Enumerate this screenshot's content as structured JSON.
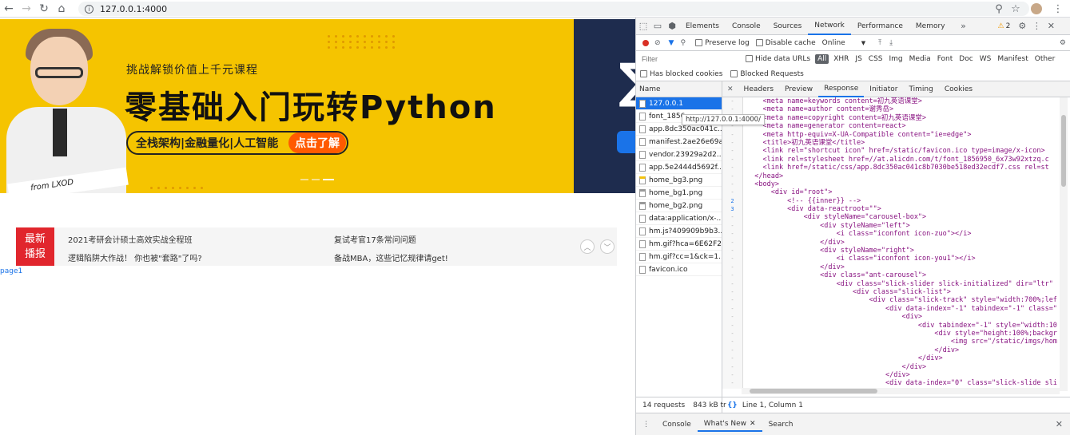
{
  "browser": {
    "url": "127.0.0.1:4000",
    "tooltip": "http://127.0.0.1:4000/"
  },
  "banner": {
    "subtitle": "挑战解锁价值上千元课程",
    "title": "零基础入门玩转Python",
    "tags": "全栈架构|金融量化|人工智能",
    "cta": "点击了解",
    "ribbon": "from LXOD"
  },
  "news": {
    "badge_line1": "最新",
    "badge_line2": "播报",
    "items": [
      "2021考研会计硕士高效实战全程班",
      "复试考官17条常问问题",
      "逻辑陷阱大作战！ 你也被\"套路\"了吗?",
      "备战MBA，这些记忆规律请get!"
    ],
    "page_link": "page1"
  },
  "devtools": {
    "tabs": [
      "Elements",
      "Console",
      "Sources",
      "Network",
      "Performance",
      "Memory"
    ],
    "warning_count": "2",
    "net": {
      "preserve_log": "Preserve log",
      "disable_cache": "Disable cache",
      "throttle": "Online"
    },
    "filter": {
      "placeholder": "Filter",
      "hide_data_urls": "Hide data URLs",
      "types": [
        "All",
        "XHR",
        "JS",
        "CSS",
        "Img",
        "Media",
        "Font",
        "Doc",
        "WS",
        "Manifest",
        "Other"
      ],
      "has_blocked_cookies": "Has blocked cookies",
      "blocked_requests": "Blocked Requests"
    },
    "list_header": "Name",
    "requests": [
      {
        "name": "127.0.0.1",
        "type": "doc"
      },
      {
        "name": "font_1856",
        "type": "doc"
      },
      {
        "name": "app.8dc350ac041c...",
        "type": "doc"
      },
      {
        "name": "manifest.2ae26e69a...",
        "type": "doc"
      },
      {
        "name": "vendor.23929a2d2...",
        "type": "doc"
      },
      {
        "name": "app.5e2444d5692f...",
        "type": "doc"
      },
      {
        "name": "home_bg3.png",
        "type": "yimg"
      },
      {
        "name": "home_bg1.png",
        "type": "img"
      },
      {
        "name": "home_bg2.png",
        "type": "img"
      },
      {
        "name": "data:application/x-...",
        "type": "doc"
      },
      {
        "name": "hm.js?409909b9b3...",
        "type": "doc"
      },
      {
        "name": "hm.gif?hca=6E62F2...",
        "type": "doc"
      },
      {
        "name": "hm.gif?cc=1&ck=1...",
        "type": "doc"
      },
      {
        "name": "favicon.ico",
        "type": "doc"
      }
    ],
    "response_tabs": [
      "Headers",
      "Preview",
      "Response",
      "Initiator",
      "Timing",
      "Cookies"
    ],
    "code_lines": [
      {
        "g": "-",
        "t": "    <meta name=keywords content=初九英语课堂>"
      },
      {
        "g": "-",
        "t": "    <meta name=author content=谢秀岳>"
      },
      {
        "g": "-",
        "t": "    <meta name=copyright content=初九英语课堂>"
      },
      {
        "g": "-",
        "t": "    <meta name=generator content=react>"
      },
      {
        "g": "-",
        "t": "    <meta http-equiv=X-UA-Compatible content=\"ie=edge\">"
      },
      {
        "g": "-",
        "t": "    <title>初九英语课堂</title>"
      },
      {
        "g": "-",
        "t": "    <link rel=\"shortcut icon\" href=/static/favicon.ico type=image/x-icon>"
      },
      {
        "g": "-",
        "t": "    <link rel=stylesheet href=//at.alicdn.com/t/font_1856950_6x73w92xtzq.c"
      },
      {
        "g": "-",
        "t": "    <link href=/static/css/app.8dc350ac041c8b7030be518ed32ecdf7.css rel=st"
      },
      {
        "g": "-",
        "t": "  </head>"
      },
      {
        "g": "-",
        "t": "  <body>"
      },
      {
        "g": "-",
        "t": "      <div id=\"root\">"
      },
      {
        "g": "2",
        "t": "          <!-- {{inner}} -->"
      },
      {
        "g": "3",
        "t": "          <div data-reactroot=\"\">"
      },
      {
        "g": "-",
        "t": "              <div styleName=\"carousel-box\">"
      },
      {
        "g": "-",
        "t": "                  <div styleName=\"left\">"
      },
      {
        "g": "-",
        "t": "                      <i class=\"iconfont icon-zuo\"></i>"
      },
      {
        "g": "-",
        "t": "                  </div>"
      },
      {
        "g": "-",
        "t": "                  <div styleName=\"right\">"
      },
      {
        "g": "-",
        "t": "                      <i class=\"iconfont icon-you1\"></i>"
      },
      {
        "g": "-",
        "t": "                  </div>"
      },
      {
        "g": "-",
        "t": "                  <div class=\"ant-carousel\">"
      },
      {
        "g": "-",
        "t": "                      <div class=\"slick-slider slick-initialized\" dir=\"ltr\""
      },
      {
        "g": "-",
        "t": "                          <div class=\"slick-list\">"
      },
      {
        "g": "-",
        "t": "                              <div class=\"slick-track\" style=\"width:700%;lef"
      },
      {
        "g": "-",
        "t": "                                  <div data-index=\"-1\" tabindex=\"-1\" class=\""
      },
      {
        "g": "-",
        "t": "                                      <div>"
      },
      {
        "g": "-",
        "t": "                                          <div tabindex=\"-1\" style=\"width:10"
      },
      {
        "g": "-",
        "t": "                                              <div style=\"height:100%;backgr"
      },
      {
        "g": "-",
        "t": "                                                  <img src=\"/static/imgs/hom"
      },
      {
        "g": "-",
        "t": "                                              </div>"
      },
      {
        "g": "-",
        "t": "                                          </div>"
      },
      {
        "g": "-",
        "t": "                                      </div>"
      },
      {
        "g": "-",
        "t": "                                  </div>"
      },
      {
        "g": "-",
        "t": "                                  <div data-index=\"0\" class=\"slick-slide sli"
      }
    ],
    "footer_requests": "14 requests",
    "footer_transferred": "843 kB tr",
    "cursor_pos": "Line 1, Column 1",
    "drawer_tabs": [
      "Console",
      "What's New",
      "Search"
    ]
  }
}
